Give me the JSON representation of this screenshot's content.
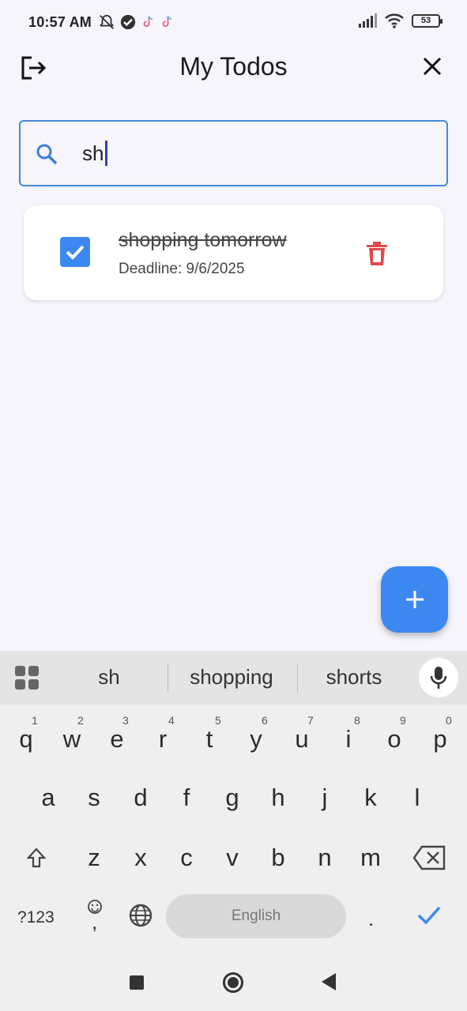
{
  "status_bar": {
    "time": "10:57 AM",
    "battery": "53",
    "left_icons": [
      "mute-alarm-icon",
      "check-circle-icon",
      "tiktok-icon",
      "tiktok-icon"
    ],
    "right_icons": [
      "signal-icon",
      "wifi-icon",
      "battery-icon"
    ]
  },
  "app_bar": {
    "title": "My Todos",
    "left_icon": "logout-icon",
    "right_icon": "close-icon"
  },
  "search": {
    "value": "sh",
    "icon": "search-icon",
    "accent_color": "#4a86d8"
  },
  "todos": [
    {
      "title": "shopping tomorrow",
      "deadline": "Deadline: 9/6/2025",
      "completed": true,
      "delete_icon": "trash-icon"
    }
  ],
  "fab": {
    "icon": "plus-icon",
    "color": "#3d88f0"
  },
  "keyboard": {
    "suggestions": [
      "sh",
      "shopping",
      "shorts"
    ],
    "row1": [
      "q",
      "w",
      "e",
      "r",
      "t",
      "y",
      "u",
      "i",
      "o",
      "p"
    ],
    "row1_hints": [
      "1",
      "2",
      "3",
      "4",
      "5",
      "6",
      "7",
      "8",
      "9",
      "0"
    ],
    "row2": [
      "a",
      "s",
      "d",
      "f",
      "g",
      "h",
      "j",
      "k",
      "l"
    ],
    "row3": [
      "z",
      "x",
      "c",
      "v",
      "b",
      "n",
      "m"
    ],
    "symbols_key": "?123",
    "comma_key": ",",
    "period_key": ".",
    "space_label": "English",
    "enter_icon": "check-icon",
    "shift_icon": "shift-arrow-icon",
    "backspace_icon": "backspace-icon",
    "globe_icon": "globe-icon",
    "emoji_icon": "emoji-icon",
    "mic_icon": "mic-icon",
    "grid_icon": "apps-grid-icon"
  },
  "nav_bar": {
    "icons": [
      "recents-square-icon",
      "home-circle-icon",
      "back-triangle-icon"
    ]
  }
}
